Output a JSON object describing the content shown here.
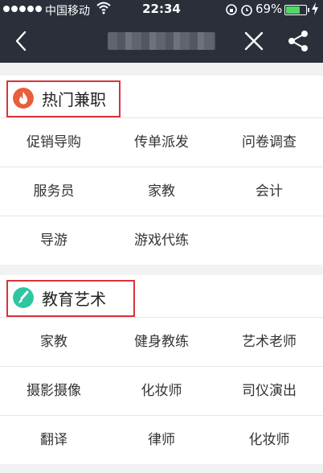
{
  "status_bar": {
    "carrier": "中国移动",
    "time": "22:34",
    "battery_percent": "69%",
    "battery_level": 0.69,
    "signal_bars": 5
  },
  "nav": {
    "back_icon": "chevron-left-icon",
    "close_icon": "close-icon",
    "share_icon": "share-icon"
  },
  "sections": [
    {
      "title": "热门兼职",
      "icon": "flame-icon",
      "icon_color": "#e95d3c",
      "items": [
        [
          "促销导购",
          "传单派发",
          "问卷调查"
        ],
        [
          "服务员",
          "家教",
          "会计"
        ],
        [
          "导游",
          "游戏代练",
          ""
        ]
      ]
    },
    {
      "title": "教育艺术",
      "icon": "brush-icon",
      "icon_color": "#2ec5a0",
      "items": [
        [
          "家教",
          "健身教练",
          "艺术老师"
        ],
        [
          "摄影摄像",
          "化妆师",
          "司仪演出"
        ],
        [
          "翻译",
          "律师",
          "化妆师"
        ]
      ]
    }
  ],
  "colors": {
    "nav_bg": "#2b2f3a",
    "highlight": "#d9333b",
    "page_bg": "#f2f2f2"
  }
}
